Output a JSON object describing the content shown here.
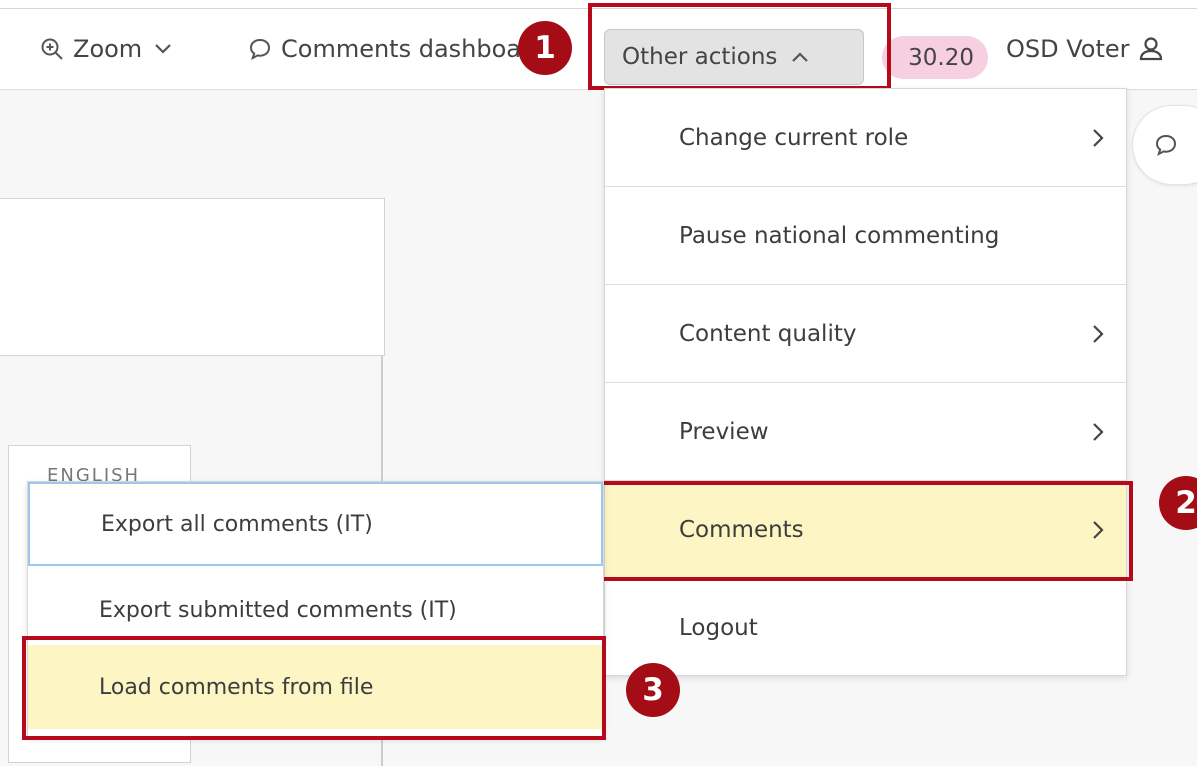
{
  "toolbar": {
    "zoom_label": "Zoom",
    "comments_dashboard_label": "Comments dashboard",
    "other_actions_label": "Other actions",
    "score": "30.20",
    "role_label": "OSD Voter"
  },
  "content": {
    "language_label": "ENGLISH"
  },
  "other_actions_menu": {
    "items": [
      {
        "label": "Change current role",
        "has_submenu": true
      },
      {
        "label": "Pause national commenting",
        "has_submenu": false
      },
      {
        "label": "Content quality",
        "has_submenu": true
      },
      {
        "label": "Preview",
        "has_submenu": true
      },
      {
        "label": "Comments",
        "has_submenu": true,
        "highlighted": true
      },
      {
        "label": "Logout",
        "has_submenu": false
      }
    ]
  },
  "comments_submenu": {
    "items": [
      {
        "label": "Export all comments (IT)",
        "focused": true
      },
      {
        "label": "Export submitted comments (IT)"
      },
      {
        "label": "Load comments from file",
        "highlighted": true
      }
    ]
  },
  "step_badges": {
    "one": "1",
    "two": "2",
    "three": "3"
  },
  "colors": {
    "annotation_red": "#b60a1c",
    "badge_red": "#a40c16",
    "highlight_yellow": "#fdf5c4",
    "score_pill_pink": "#f6cfe0",
    "focus_blue": "#9cc7ef"
  },
  "icons": {
    "zoom": "zoom-in-icon",
    "comments_dashboard": "speech-bubble-icon",
    "menu_open": "chevron-up-icon",
    "zoom_dropdown": "chevron-down-icon",
    "user": "user-icon",
    "submenu_arrow": "chevron-right-icon",
    "side_comments": "speech-bubble-icon"
  }
}
